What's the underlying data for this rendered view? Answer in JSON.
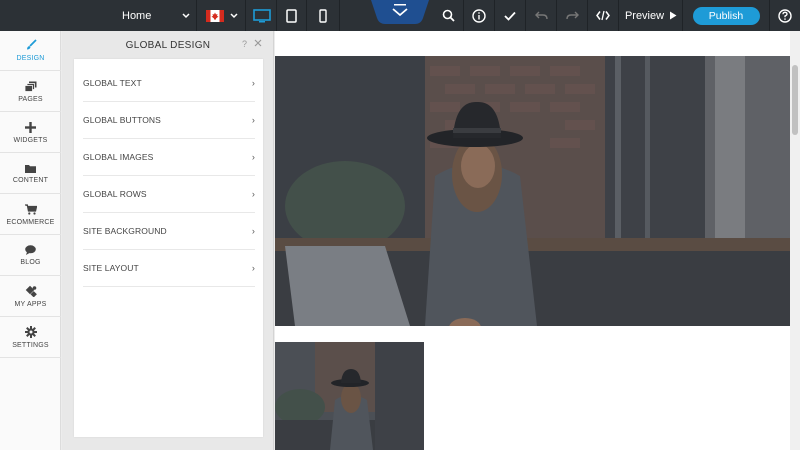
{
  "toolbar": {
    "page_select_value": "Home",
    "preview_label": "Preview",
    "publish_label": "Publish"
  },
  "sidebar": {
    "items": [
      {
        "label": "DESIGN",
        "icon": "brush-icon"
      },
      {
        "label": "PAGES",
        "icon": "pages-icon"
      },
      {
        "label": "WIDGETS",
        "icon": "plus-icon"
      },
      {
        "label": "CONTENT",
        "icon": "folder-icon"
      },
      {
        "label": "ECOMMERCE",
        "icon": "cart-icon"
      },
      {
        "label": "BLOG",
        "icon": "chat-bubble-icon"
      },
      {
        "label": "MY APPS",
        "icon": "puzzle-icon"
      },
      {
        "label": "SETTINGS",
        "icon": "gear-icon"
      }
    ]
  },
  "panel": {
    "title": "GLOBAL DESIGN",
    "help": "?",
    "items": [
      {
        "label": "GLOBAL TEXT"
      },
      {
        "label": "GLOBAL BUTTONS"
      },
      {
        "label": "GLOBAL IMAGES"
      },
      {
        "label": "GLOBAL ROWS"
      },
      {
        "label": "SITE BACKGROUND"
      },
      {
        "label": "SITE LAYOUT"
      }
    ]
  },
  "colors": {
    "accent": "#1e9bd7",
    "toolbar_bg": "#2c3136"
  }
}
